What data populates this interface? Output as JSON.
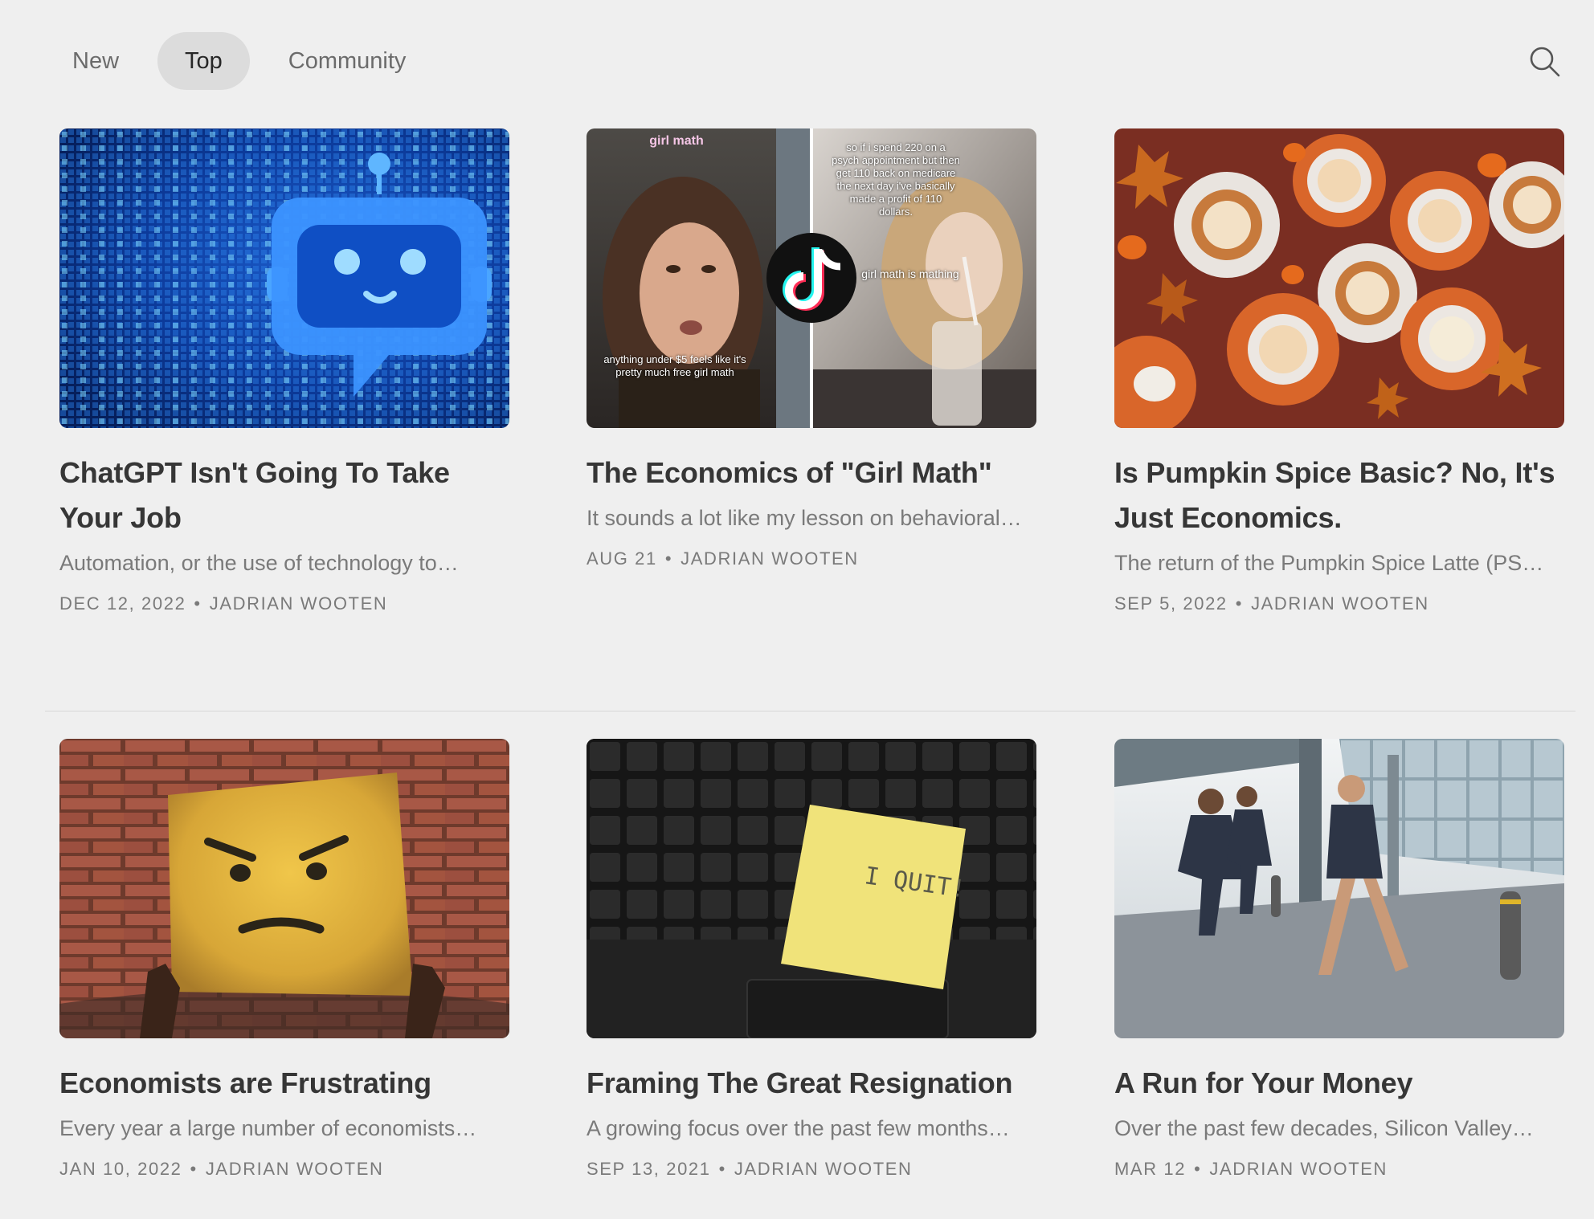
{
  "tabs": [
    {
      "label": "New",
      "active": false
    },
    {
      "label": "Top",
      "active": true
    },
    {
      "label": "Community",
      "active": false
    }
  ],
  "search": {
    "icon": "search-icon"
  },
  "posts": [
    {
      "title": "ChatGPT Isn't Going To Take Your Job",
      "excerpt": "Automation, or the use of technology to…",
      "date": "DEC 12, 2022",
      "author": "JADRIAN WOOTEN"
    },
    {
      "title": "The Economics of \"Girl Math\"",
      "excerpt": "It sounds a lot like my lesson on behavioral…",
      "date": "AUG 21",
      "author": "JADRIAN WOOTEN",
      "image_text": {
        "left_top": "girl math",
        "left_bottom": "anything under $5 feels like it's pretty much free girl math",
        "right_top": "so if i spend 220 on a psych appointment but then get 110 back on medicare the next day i've basically made a profit of 110 dollars.",
        "right_mid": "girl math is mathing"
      }
    },
    {
      "title": "Is Pumpkin Spice Basic? No, It's Just Economics.",
      "excerpt": "The return of the Pumpkin Spice Latte (PS…",
      "date": "SEP 5, 2022",
      "author": "JADRIAN WOOTEN"
    },
    {
      "title": "Economists are Frustrating",
      "excerpt": "Every year a large number of economists…",
      "date": "JAN 10, 2022",
      "author": "JADRIAN WOOTEN"
    },
    {
      "title": "Framing The Great Resignation",
      "excerpt": "A growing focus over the past few months…",
      "date": "SEP 13, 2021",
      "author": "JADRIAN WOOTEN",
      "image_text": {
        "note": "I QUIT!"
      }
    },
    {
      "title": "A Run for Your Money",
      "excerpt": "Over the past few decades, Silicon Valley…",
      "date": "MAR 12",
      "author": "JADRIAN WOOTEN"
    }
  ],
  "meta_separator": "•"
}
